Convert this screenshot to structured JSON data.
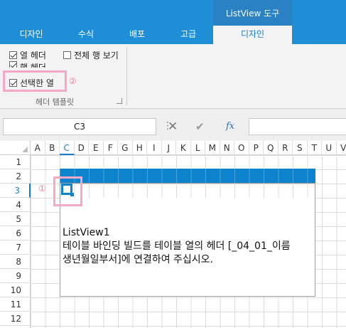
{
  "ribbon": {
    "context_group": "ListView 도구",
    "tabs": [
      "디자인",
      "수식",
      "배포",
      "고급",
      "디자인"
    ],
    "active_tab_index": 4
  },
  "design_group": {
    "options": [
      {
        "label": "열 헤더",
        "checked": true
      },
      {
        "label": "전체 행 보기",
        "checked": false
      },
      {
        "label": "행 헤더",
        "checked": true
      },
      {
        "label": "선택한 열",
        "checked": true
      }
    ],
    "group_label": "헤더 템플릿"
  },
  "formula_bar": {
    "cell_reference": "C3",
    "formula": ""
  },
  "sheet": {
    "columns": [
      "A",
      "B",
      "C",
      "D",
      "E",
      "F",
      "G",
      "H",
      "I",
      "J",
      "K",
      "L",
      "M",
      "N",
      "O",
      "P",
      "Q",
      "R",
      "S",
      "T",
      "U",
      "V"
    ],
    "rows": [
      "1",
      "2",
      "3",
      "4",
      "5",
      "6",
      "7",
      "8",
      "9",
      "10",
      "11",
      "12"
    ],
    "selected_column": "C",
    "selected_row": "3"
  },
  "listview": {
    "name": "ListView1",
    "instruction": "테이블 바인딩 빌드를 테이블 열의 헤더 [_04_01_이름\n생년월일부서]에 연결하여 주십시오."
  },
  "annotations": {
    "marker_1": "①",
    "marker_2": "②"
  },
  "colors": {
    "ribbon": "#1e8fd6",
    "accent": "#0d82cd",
    "highlight": "#f6a8c8"
  }
}
